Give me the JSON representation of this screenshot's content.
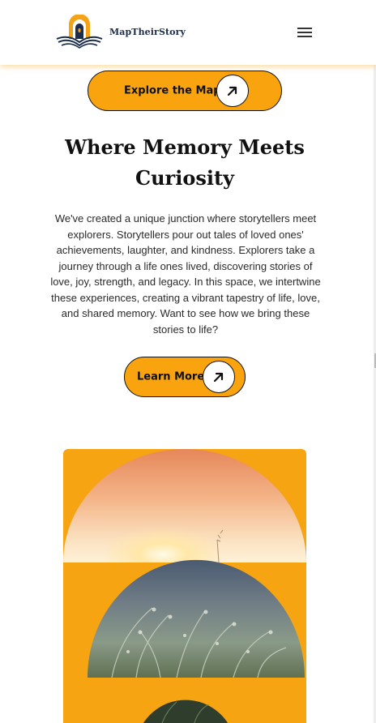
{
  "header": {
    "brand": "MapTheirStory",
    "logo_icon": "book-arch-logo-icon",
    "menu_icon": "hamburger-menu-icon"
  },
  "hero": {
    "explore_button_label": "Explore the Map",
    "explore_button_icon": "arrow-up-right-icon",
    "heading_line1": "Where Memory Meets",
    "heading_line2": "Curiosity",
    "paragraph": "We've created a unique junction where storytellers meet explorers. Storytellers pour out tales of loved ones' achievements, laughter, and kindness. Explorers take a journey through a life ones lived, discovering stories of love, joy, strength, and legacy. In this space, we intertwine these experiences, creating a vibrant tapestry of life, love, and shared memory. Want to see how we bring these stories to life?",
    "learn_button_label": "Learn More",
    "learn_button_icon": "arrow-up-right-icon"
  },
  "colors": {
    "accent": "#f9a40f",
    "brand_navy": "#1b2d4a",
    "text_dark": "#111111"
  }
}
